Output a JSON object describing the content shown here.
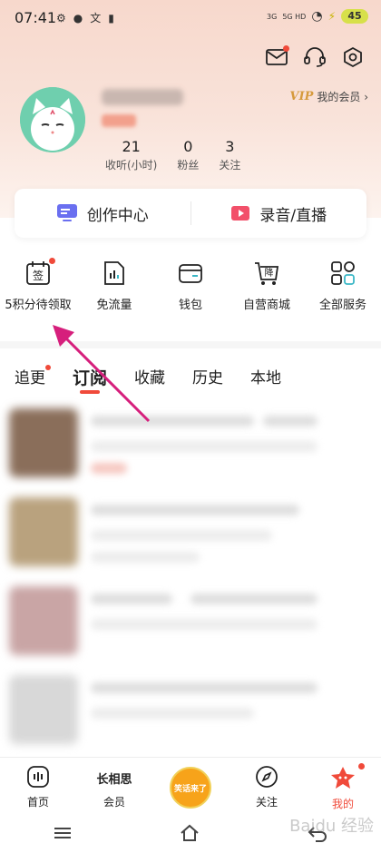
{
  "status_bar": {
    "time": "07:41",
    "net1": "3G",
    "net2": "5G HD",
    "battery": "45"
  },
  "profile": {
    "vip_badge": "VIP",
    "vip_label": "我的会员 ›",
    "stats": [
      {
        "value": "21",
        "label": "收听(小时)"
      },
      {
        "value": "0",
        "label": "粉丝"
      },
      {
        "value": "3",
        "label": "关注"
      }
    ]
  },
  "create_card": {
    "left_label": "创作中心",
    "right_label": "录音/直播"
  },
  "services": [
    {
      "label": "5积分待领取",
      "icon": "sign-in-icon"
    },
    {
      "label": "免流量",
      "icon": "data-icon"
    },
    {
      "label": "钱包",
      "icon": "wallet-icon"
    },
    {
      "label": "自营商城",
      "icon": "mall-icon"
    },
    {
      "label": "全部服务",
      "icon": "grid-icon"
    }
  ],
  "sign_icon_char": "签",
  "mall_icon_char": "降",
  "tabs": [
    {
      "label": "追更"
    },
    {
      "label": "订阅"
    },
    {
      "label": "收藏"
    },
    {
      "label": "历史"
    },
    {
      "label": "本地"
    }
  ],
  "bottom_nav": [
    {
      "label": "首页"
    },
    {
      "label": "会员"
    },
    {
      "label": ""
    },
    {
      "label": "关注"
    },
    {
      "label": "我的"
    }
  ],
  "center_disc_text": "笑话来了",
  "member_icon_text": "长相思",
  "watermark": "Baidu 经验",
  "colors": {
    "accent": "#f04a3a",
    "arrow": "#d61f7c",
    "vip": "#d69a3c"
  }
}
